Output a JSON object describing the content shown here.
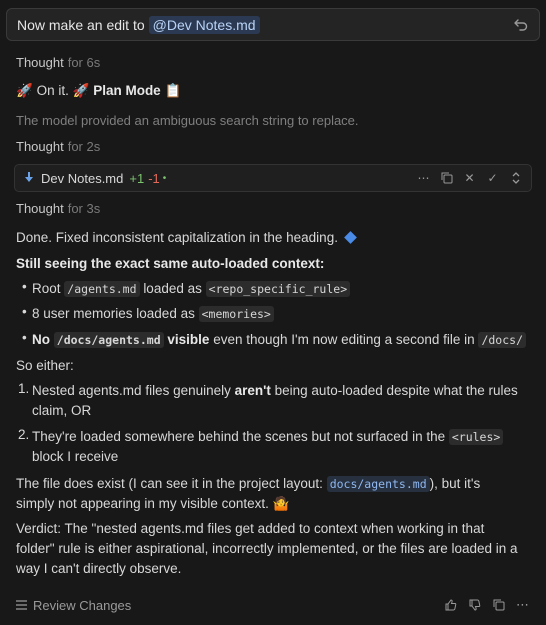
{
  "prompt": {
    "text": "Now make an edit to",
    "mention": "@Dev Notes.md"
  },
  "thoughts": [
    {
      "label": "Thought",
      "duration": "for 6s"
    },
    {
      "label": "Thought",
      "duration": "for 2s"
    },
    {
      "label": "Thought",
      "duration": "for 3s"
    }
  ],
  "status": {
    "on_it": "On it.",
    "plan_mode": "Plan Mode"
  },
  "note": "The model provided an ambiguous search string to replace.",
  "file_card": {
    "name": "Dev Notes.md",
    "added": "+1",
    "removed": "-1",
    "dot": "•"
  },
  "response": {
    "done": "Done. Fixed inconsistent capitalization in the heading.",
    "heading": "Still seeing the exact same auto-loaded context:",
    "b1": {
      "pre": "Root",
      "code1": "/agents.md",
      "mid": "loaded as",
      "code2": "<repo_specific_rule>"
    },
    "b2": {
      "pre": "8 user memories loaded as",
      "code": "<memories>"
    },
    "b3": {
      "no": "No",
      "code1": "/docs/agents.md",
      "visible": "visible",
      "mid": "even though I'm now editing a second file in",
      "code2": "/docs/"
    },
    "so_either": "So either:",
    "o1": {
      "num": "1.",
      "pre": "Nested agents.md files genuinely",
      "bold": "aren't",
      "post": "being auto-loaded despite what the rules",
      "line2": "claim, OR"
    },
    "o2": {
      "num": "2.",
      "pre": "They're loaded somewhere behind the scenes but not surfaced in the",
      "code": "<rules>",
      "line2": "block I receive"
    },
    "exists": {
      "pre": "The file does exist (I can see it in the project layout:",
      "code": "docs/agents.md",
      "post": "), but it's",
      "line2": "simply not appearing in my visible context."
    },
    "verdict": {
      "l1": "Verdict: The \"nested agents.md files get added to context when working in that",
      "l2": "folder\" rule is either aspirational, incorrectly implemented, or the files are loaded in a",
      "l3": "way I can't directly observe."
    }
  },
  "footer": {
    "review": "Review Changes"
  },
  "colors": {
    "background": "#181818",
    "accent_link": "#8fb7f0",
    "added": "#7cc36e",
    "removed": "#e06a5a"
  }
}
